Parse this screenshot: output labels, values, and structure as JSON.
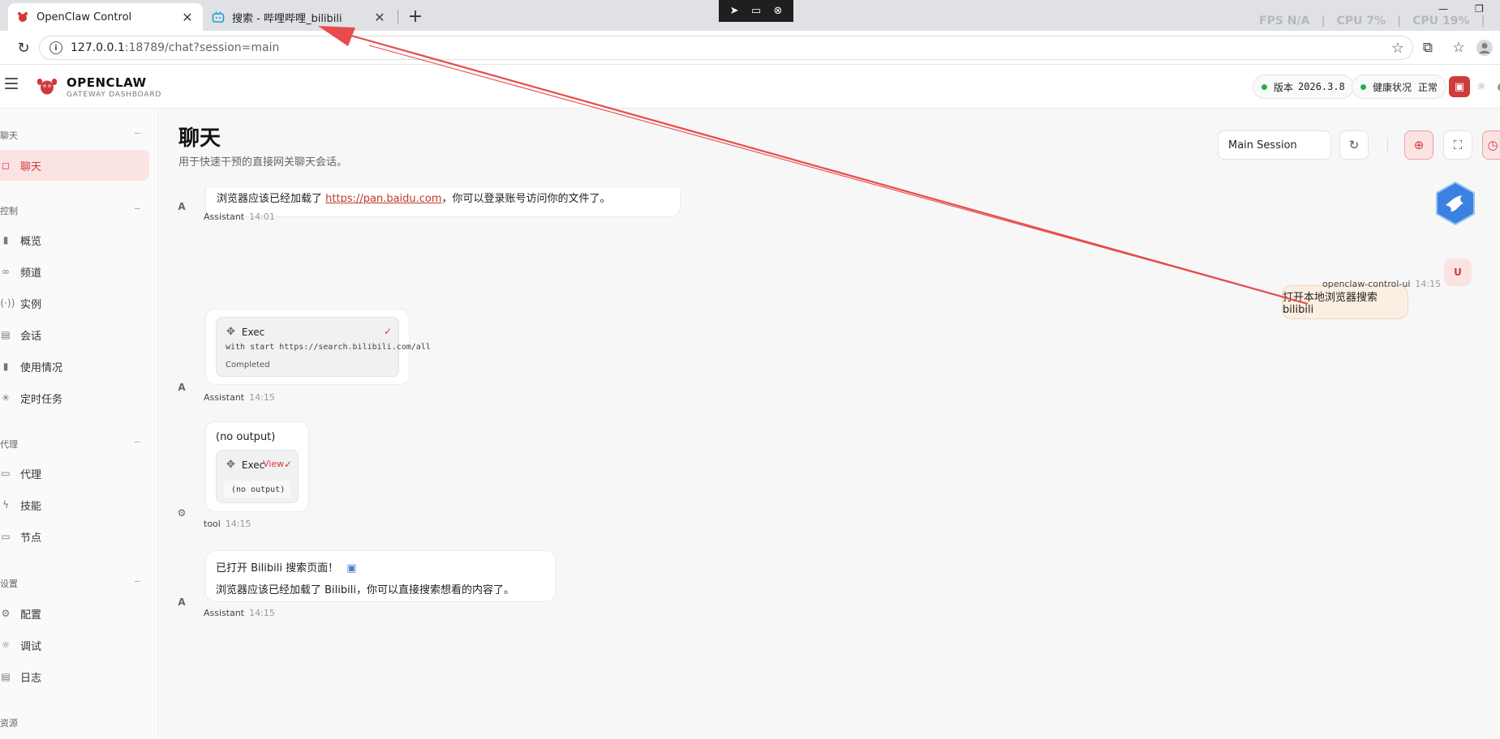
{
  "browser": {
    "tabs": [
      {
        "title": "OpenClaw Control",
        "active": true,
        "icon": "lobster-icon"
      },
      {
        "title": "搜索 - 哔哩哔哩_bilibili",
        "active": false,
        "icon": "bilibili-icon"
      }
    ],
    "stats": {
      "fps": "FPS N/A",
      "cpu1": "CPU 7%",
      "cpu2": "CPU 19%"
    },
    "url_host": "127.0.0.1",
    "url_rest": ":18789/chat?session=main"
  },
  "header": {
    "brand_name": "OPENCLAW",
    "brand_sub": "GATEWAY DASHBOARD",
    "version_label": "版本",
    "version_value": "2026.3.8",
    "health_label": "健康状况",
    "health_value": "正常",
    "status_color": "#22b14c",
    "accent_color": "#d03a3a"
  },
  "sidebar": {
    "sections": [
      {
        "title": "聊天",
        "items": [
          {
            "label": "聊天",
            "icon": "chat-bubble-icon",
            "active": true
          }
        ]
      },
      {
        "title": "控制",
        "items": [
          {
            "label": "概览",
            "icon": "bar-chart-icon"
          },
          {
            "label": "频道",
            "icon": "link-icon"
          },
          {
            "label": "实例",
            "icon": "radio-icon"
          },
          {
            "label": "会话",
            "icon": "document-icon"
          },
          {
            "label": "使用情况",
            "icon": "bar-chart-icon"
          },
          {
            "label": "定时任务",
            "icon": "loader-icon"
          }
        ]
      },
      {
        "title": "代理",
        "items": [
          {
            "label": "代理",
            "icon": "folder-icon"
          },
          {
            "label": "技能",
            "icon": "lightning-icon"
          },
          {
            "label": "节点",
            "icon": "monitor-icon"
          }
        ]
      },
      {
        "title": "设置",
        "items": [
          {
            "label": "配置",
            "icon": "gear-icon"
          },
          {
            "label": "调试",
            "icon": "bug-icon"
          },
          {
            "label": "日志",
            "icon": "log-icon"
          }
        ]
      },
      {
        "title": "资源",
        "items": []
      }
    ]
  },
  "main": {
    "title": "聊天",
    "subtitle": "用于快速干预的直接网关聊天会话。",
    "session_select": "Main Session"
  },
  "chat": {
    "msg1_text_before": "浏览器应该已经加载了 ",
    "msg1_link": "https://pan.baidu.com",
    "msg1_text_after": "，你可以登录账号访问你的文件了。",
    "msg1_role": "Assistant",
    "msg1_time": "14:01",
    "user_text": "打开本地浏览器搜索bilibili",
    "user_avatar": "U",
    "user_name": "openclaw-control-ui",
    "user_time": "14:15",
    "exec1_label": "Exec",
    "exec1_cmd": "with start https://search.bilibili.com/all",
    "exec1_status": "Completed",
    "msg2_role": "Assistant",
    "msg2_time": "14:15",
    "tool_output": "(no output)",
    "exec2_label": "Exec",
    "exec2_view": "View",
    "exec2_output": "(no output)",
    "msg3_role": "tool",
    "msg3_time": "14:15",
    "msg4_line1": "已打开 Bilibili 搜索页面！",
    "msg4_line2": "浏览器应该已经加载了 Bilibili，你可以直接搜索想看的内容了。",
    "msg4_role": "Assistant",
    "msg4_time": "14:15",
    "assistant_avatar": "A"
  }
}
